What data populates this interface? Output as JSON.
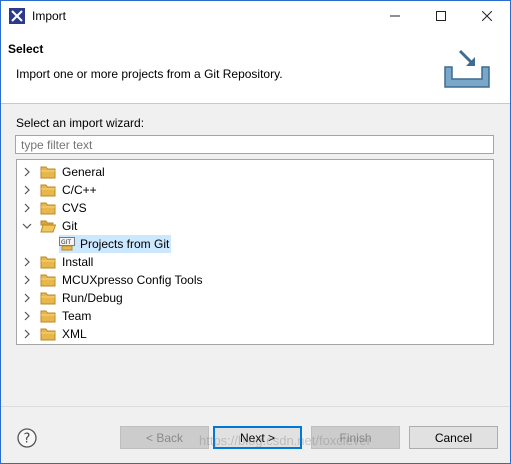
{
  "window": {
    "title": "Import"
  },
  "banner": {
    "title": "Select",
    "description": "Import one or more projects from a Git Repository."
  },
  "wizard": {
    "label": "Select an import wizard:",
    "filter_placeholder": "type filter text"
  },
  "tree": {
    "items": [
      {
        "label": "General",
        "expanded": false
      },
      {
        "label": "C/C++",
        "expanded": false
      },
      {
        "label": "CVS",
        "expanded": false
      },
      {
        "label": "Git",
        "expanded": true,
        "children": [
          {
            "label": "Projects from Git",
            "selected": true
          }
        ]
      },
      {
        "label": "Install",
        "expanded": false
      },
      {
        "label": "MCUXpresso Config Tools",
        "expanded": false
      },
      {
        "label": "Run/Debug",
        "expanded": false
      },
      {
        "label": "Team",
        "expanded": false
      },
      {
        "label": "XML",
        "expanded": false
      }
    ]
  },
  "buttons": {
    "back": "< Back",
    "next": "Next >",
    "finish": "Finish",
    "cancel": "Cancel"
  },
  "watermark": "https://blog.csdn.net/foxclever",
  "colors": {
    "folder": "#e8b64a",
    "selection": "#cce8ff",
    "accent": "#0078d7"
  }
}
